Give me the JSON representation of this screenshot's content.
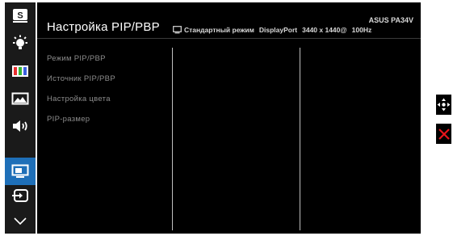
{
  "sidebar": {
    "items": [
      {
        "icon": "splendid-s-icon",
        "label": "S"
      },
      {
        "icon": "blue-light-icon"
      },
      {
        "icon": "color-bars-icon"
      },
      {
        "icon": "image-icon"
      },
      {
        "icon": "sound-icon"
      },
      {
        "icon": "pip-pbp-icon",
        "active": true
      },
      {
        "icon": "input-select-icon"
      },
      {
        "icon": "chevron-down-icon"
      }
    ],
    "active_color": "#1e6fb8"
  },
  "header": {
    "title": "Настройка PIP/PBP",
    "mode": "Стандартный режим",
    "input": "DisplayPort",
    "resolution": "3440 x 1440@",
    "refresh": "100Hz",
    "model": "ASUS PA34V"
  },
  "menu": {
    "items": [
      "Режим PIP/PBP",
      "Источник PIP/PBP",
      "Настройка цвета",
      "PIP-размер"
    ]
  },
  "nav_keys": [
    {
      "icon": "five-way-navigation-icon",
      "color": "#ffffff"
    },
    {
      "icon": "close-icon",
      "color": "#e8141b"
    }
  ]
}
